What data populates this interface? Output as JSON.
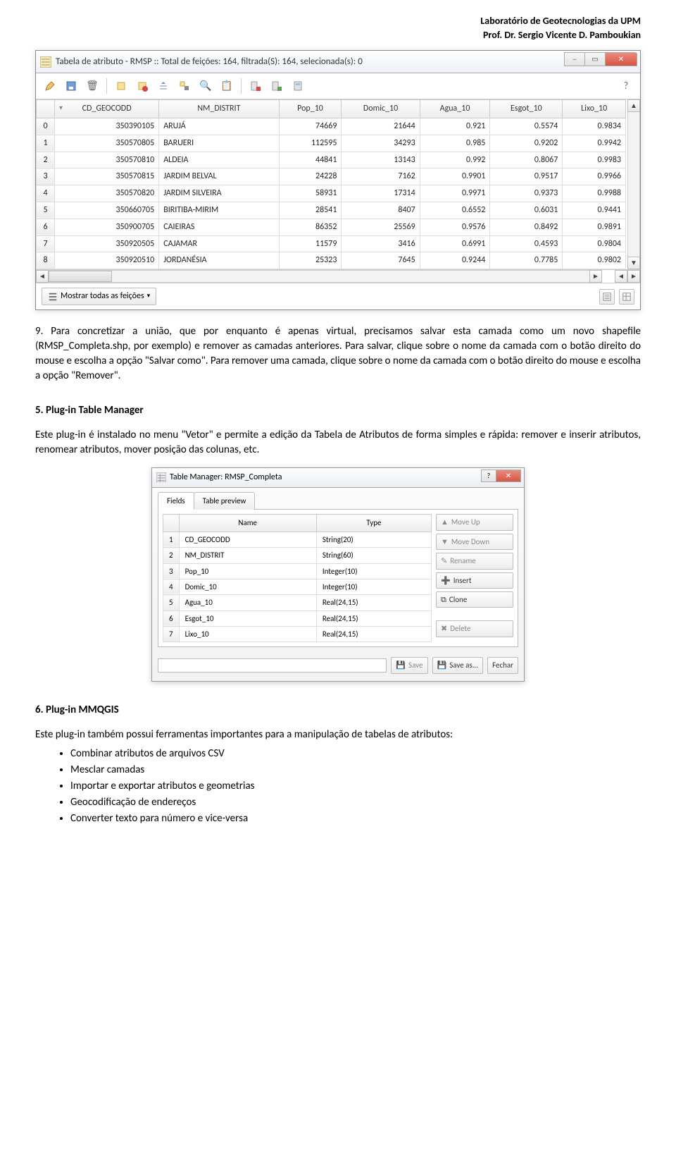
{
  "header": {
    "line1": "Laboratório de Geotecnologias da UPM",
    "line2": "Prof. Dr. Sergio Vicente D. Pamboukian"
  },
  "win1": {
    "title": "Tabela de atributo - RMSP :: Total de feições: 164, filtrada(S): 164, selecionada(s): 0",
    "columns": [
      "CD_GEOCODD",
      "NM_DISTRIT",
      "Pop_10",
      "Domic_10",
      "Agua_10",
      "Esgot_10",
      "Lixo_10"
    ],
    "rows": [
      {
        "idx": "0",
        "cells": [
          "350390105",
          "ARUJÁ",
          "74669",
          "21644",
          "0.921",
          "0.5574",
          "0.9834"
        ]
      },
      {
        "idx": "1",
        "cells": [
          "350570805",
          "BARUERI",
          "112595",
          "34293",
          "0.985",
          "0.9202",
          "0.9942"
        ]
      },
      {
        "idx": "2",
        "cells": [
          "350570810",
          "ALDEIA",
          "44841",
          "13143",
          "0.992",
          "0.8067",
          "0.9983"
        ]
      },
      {
        "idx": "3",
        "cells": [
          "350570815",
          "JARDIM BELVAL",
          "24228",
          "7162",
          "0.9901",
          "0.9517",
          "0.9966"
        ]
      },
      {
        "idx": "4",
        "cells": [
          "350570820",
          "JARDIM SILVEIRA",
          "58931",
          "17314",
          "0.9971",
          "0.9373",
          "0.9988"
        ]
      },
      {
        "idx": "5",
        "cells": [
          "350660705",
          "BIRITIBA-MIRIM",
          "28541",
          "8407",
          "0.6552",
          "0.6031",
          "0.9441"
        ]
      },
      {
        "idx": "6",
        "cells": [
          "350900705",
          "CAIEIRAS",
          "86352",
          "25569",
          "0.9576",
          "0.8492",
          "0.9891"
        ]
      },
      {
        "idx": "7",
        "cells": [
          "350920505",
          "CAJAMAR",
          "11579",
          "3416",
          "0.6991",
          "0.4593",
          "0.9804"
        ]
      },
      {
        "idx": "8",
        "cells": [
          "350920510",
          "JORDANÉSIA",
          "25323",
          "7645",
          "0.9244",
          "0.7785",
          "0.9802"
        ]
      }
    ],
    "show_all": "Mostrar todas as feições",
    "help": "?"
  },
  "para9": "9. Para concretizar a união, que por enquanto é apenas virtual, precisamos salvar esta camada como um novo shapefile (RMSP_Completa.shp, por exemplo) e remover as camadas anteriores. Para salvar, clique sobre o nome da camada com o botão direito do mouse e escolha a opção \"Salvar como\". Para remover uma camada, clique sobre o nome da camada com o botão direito do mouse e escolha a opção \"Remover\".",
  "sect5": {
    "title": "5. Plug-in Table Manager",
    "body": "Este plug-in é instalado no menu \"Vetor\" e permite a edição da Tabela de Atributos de forma simples e rápida: remover e inserir atributos, renomear atributos, mover posição das colunas, etc."
  },
  "win2": {
    "title": "Table Manager: RMSP_Completa",
    "tabs": [
      "Fields",
      "Table preview"
    ],
    "columns": [
      "Name",
      "Type"
    ],
    "rows": [
      {
        "idx": "1",
        "name": "CD_GEOCODD",
        "type": "String(20)"
      },
      {
        "idx": "2",
        "name": "NM_DISTRIT",
        "type": "String(60)"
      },
      {
        "idx": "3",
        "name": "Pop_10",
        "type": "Integer(10)"
      },
      {
        "idx": "4",
        "name": "Domic_10",
        "type": "Integer(10)"
      },
      {
        "idx": "5",
        "name": "Agua_10",
        "type": "Real(24,15)"
      },
      {
        "idx": "6",
        "name": "Esgot_10",
        "type": "Real(24,15)"
      },
      {
        "idx": "7",
        "name": "Lixo_10",
        "type": "Real(24,15)"
      }
    ],
    "side": {
      "moveup": "Move Up",
      "movedown": "Move Down",
      "rename": "Rename",
      "insert": "Insert",
      "clone": "Clone",
      "delete": "Delete"
    },
    "footer": {
      "save": "Save",
      "saveas": "Save as...",
      "close": "Fechar"
    }
  },
  "sect6": {
    "title": "6. Plug-in MMQGIS",
    "body": "Este plug-in também possui ferramentas importantes para a manipulação de tabelas de atributos:",
    "bullets": [
      "Combinar atributos de arquivos CSV",
      "Mesclar camadas",
      "Importar e exportar atributos e geometrias",
      "Geocodificação de endereços",
      "Converter texto para número e vice-versa"
    ]
  }
}
